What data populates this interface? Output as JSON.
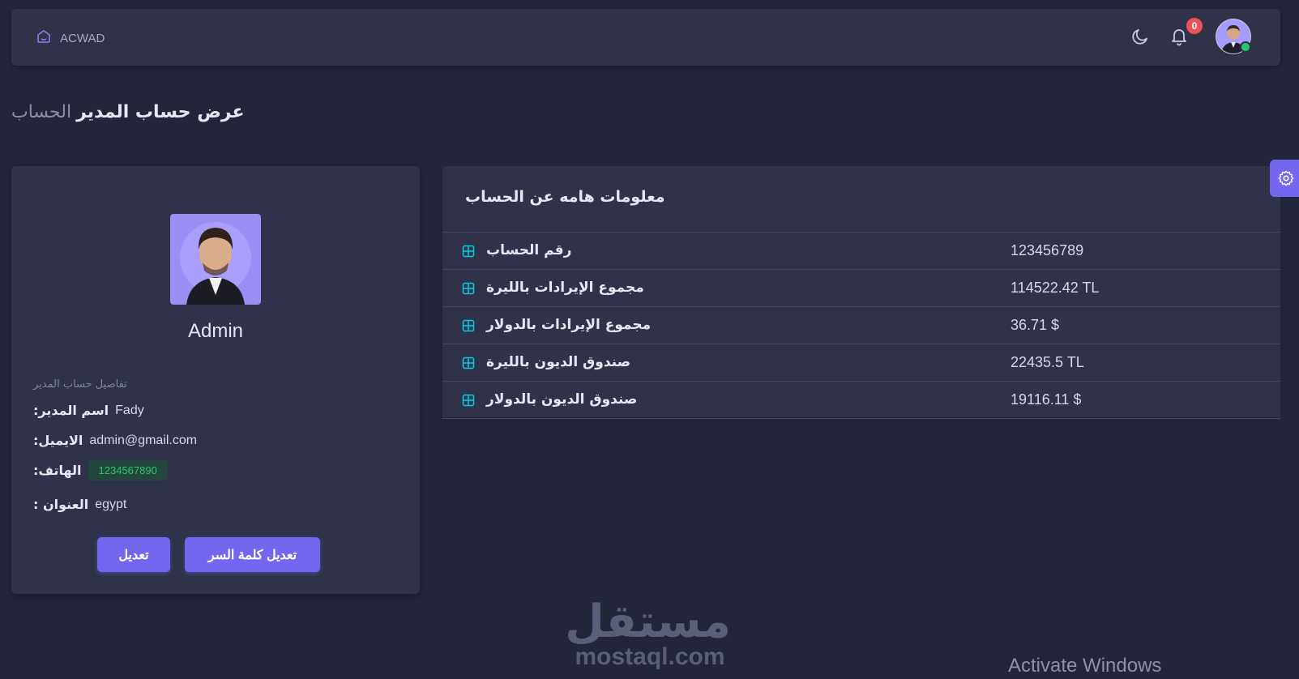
{
  "navbar": {
    "brand": "ACWAD",
    "notifications_count": "0"
  },
  "breadcrumb": {
    "parent": "الحساب",
    "current": "عرض حساب المدير"
  },
  "profile": {
    "name": "Admin",
    "details_title": "تفاصيل حساب المدير",
    "fields": [
      {
        "label": "اسم المدير:",
        "value": "Fady"
      },
      {
        "label": "الايميل:",
        "value": "admin@gmail.com"
      },
      {
        "label": "الهاتف:",
        "value": "1234567890"
      },
      {
        "label": "العنوان :",
        "value": "egypt"
      }
    ],
    "edit_button": "تعديل",
    "edit_password_button": "تعديل كلمة السر"
  },
  "info": {
    "title": "معلومات هامه عن الحساب",
    "rows": [
      {
        "label": "رقم الحساب",
        "value": "123456789"
      },
      {
        "label": "مجموع الإيرادات بالليرة",
        "value": "114522.42 TL"
      },
      {
        "label": "مجموع الإيرادات بالدولار",
        "value": "36.71 $"
      },
      {
        "label": "صندوق الديون بالليرة",
        "value": "22435.5 TL"
      },
      {
        "label": "صندوق الديون بالدولار",
        "value": "19116.11 $"
      }
    ]
  },
  "watermark": {
    "arabic": "مستقل",
    "latin": "mostaql.com"
  },
  "os_overlay": "Activate Windows",
  "colors": {
    "background": "#232539",
    "card": "#2f3248",
    "primary": "#7367f0",
    "success": "#28c76f",
    "danger": "#ea5455",
    "icon_accent": "#00cfe8"
  },
  "icons": {
    "brand": "home-outline-icon",
    "theme": "moon-icon",
    "notifications": "bell-icon",
    "settings": "gear-icon",
    "row": "grid-icon"
  }
}
